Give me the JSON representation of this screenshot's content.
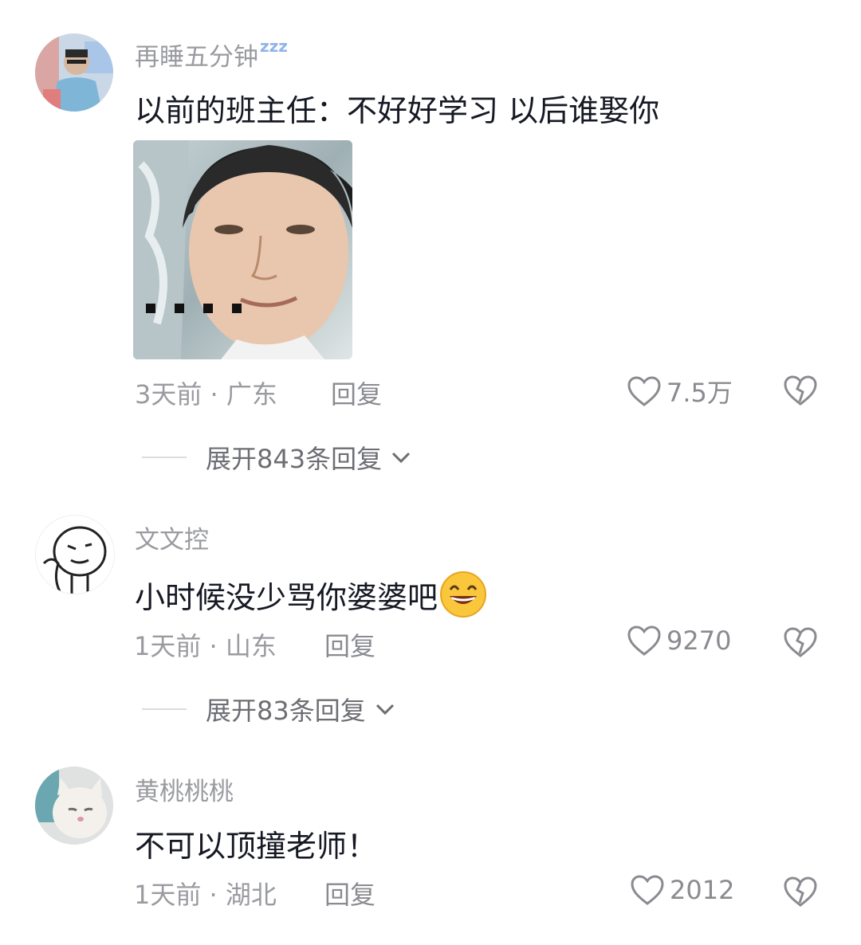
{
  "comments": [
    {
      "username": "再睡五分钟",
      "username_badge": "zzz",
      "text": "以前的班主任：不好好学习 以后谁娶你",
      "time": "3天前 · 广东",
      "reply_label": "回复",
      "likes": "7.5万",
      "expand_label": "展开843条回复"
    },
    {
      "username": "文文控",
      "text": "小时候没少骂你婆婆吧",
      "emoji": "grinning-face",
      "time": "1天前 · 山东",
      "reply_label": "回复",
      "likes": "9270",
      "expand_label": "展开83条回复"
    },
    {
      "username": "黄桃桃桃",
      "text": "不可以顶撞老师！",
      "time": "1天前 · 湖北",
      "reply_label": "回复",
      "likes": "2012"
    }
  ],
  "icons": {
    "like": "heart-outline-icon",
    "dislike": "broken-heart-icon",
    "expand": "chevron-down-icon"
  },
  "colors": {
    "background": "#ffffff",
    "text": "#161823",
    "secondary": "#9a9ba0"
  }
}
